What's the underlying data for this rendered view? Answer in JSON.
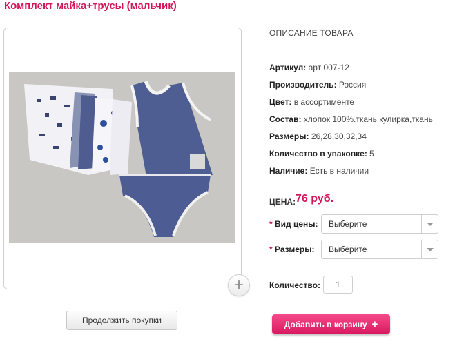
{
  "product": {
    "title": "Комплект майка+трусы (мальчик)"
  },
  "description": {
    "heading": "ОПИСАНИЕ ТОВАРА",
    "attributes": [
      {
        "label": "Артикул:",
        "value": "арт 007-12"
      },
      {
        "label": "Производитель:",
        "value": "Россия"
      },
      {
        "label": "Цвет:",
        "value": "в ассортименте"
      },
      {
        "label": "Состав:",
        "value": "хлопок 100%.ткань кулирка,ткань"
      },
      {
        "label": "Размеры:",
        "value": "26,28,30,32,34"
      },
      {
        "label": "Количество в упаковке:",
        "value": "5"
      },
      {
        "label": "Наличие:",
        "value": "Есть в наличии"
      }
    ]
  },
  "price": {
    "label": "ЦЕНА:",
    "value": "76 руб."
  },
  "options": [
    {
      "required_mark": "*",
      "label": "Вид цены:",
      "selected": "Выберите"
    },
    {
      "required_mark": "*",
      "label": "Размеры:",
      "selected": "Выберите"
    }
  ],
  "quantity": {
    "label": "Количество:",
    "value": "1"
  },
  "buttons": {
    "continue": "Продолжить покупки",
    "add_to_cart": "Добавить в корзину",
    "add_to_cart_icon": "+",
    "zoom_icon": "+"
  },
  "colors": {
    "accent": "#d4145a",
    "cart_button": "#e8266f"
  }
}
